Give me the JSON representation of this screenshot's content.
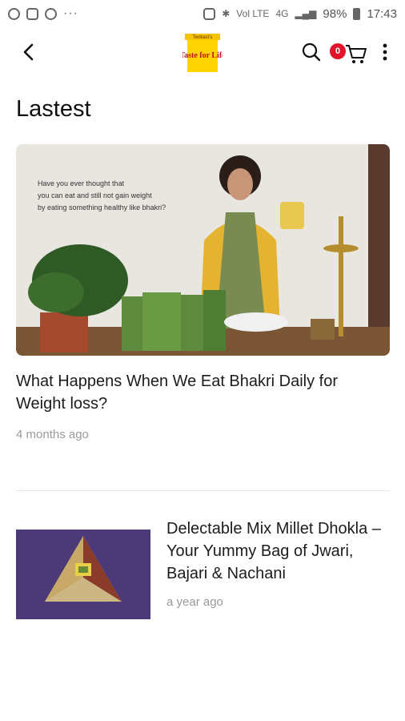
{
  "status_bar": {
    "battery": "98%",
    "time": "17:43",
    "dots": "···",
    "network_label": "Vol LTE",
    "signal_label": "4G"
  },
  "app_bar": {
    "logo_text": "Taste for Life",
    "logo_small": "Tenkasi's",
    "cart_count": "0"
  },
  "section": {
    "title": "Lastest"
  },
  "articles": [
    {
      "title": "What Happens When We Eat Bhakri Daily for Weight loss?",
      "time": "4 months ago",
      "image_caption": [
        "Have you ever thought that",
        "you can eat and still not gain weight",
        "by eating something healthy like bhakri?"
      ]
    },
    {
      "title": "Delectable Mix Millet Dhokla – Your Yummy Bag of Jwari, Bajari & Nachani",
      "time": "a year ago"
    }
  ],
  "colors": {
    "badge": "#e3132b",
    "thumb_bg": "#4c3a78",
    "logo_yellow": "#f5c400"
  }
}
